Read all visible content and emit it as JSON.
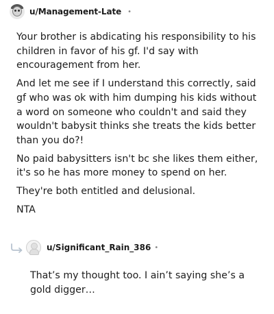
{
  "comment": {
    "username": "u/Management-Late",
    "separator": "•",
    "avatar_icon": "snoo-avatar-icon",
    "paragraphs": [
      "Your brother is abdicating his responsibility to his children in favor of his gf. I'd say with encouragement from her.",
      "And let me see if I understand this correctly, said gf who was ok with him dumping his kids without a word on someone who couldn't and said they wouldn't babysit thinks she treats the kids better than you do?!",
      "No paid babysitters isn't bc she likes them either, it's so he has more money to spend on her.",
      "They're both entitled and delusional.",
      "NTA"
    ]
  },
  "reply": {
    "username": "u/Significant_Rain_386",
    "separator": "•",
    "reply_icon": "reply-arrow-icon",
    "avatar_icon": "default-avatar-icon",
    "paragraphs": [
      "That’s my thought too. I ain’t saying she’s a gold digger…"
    ]
  }
}
